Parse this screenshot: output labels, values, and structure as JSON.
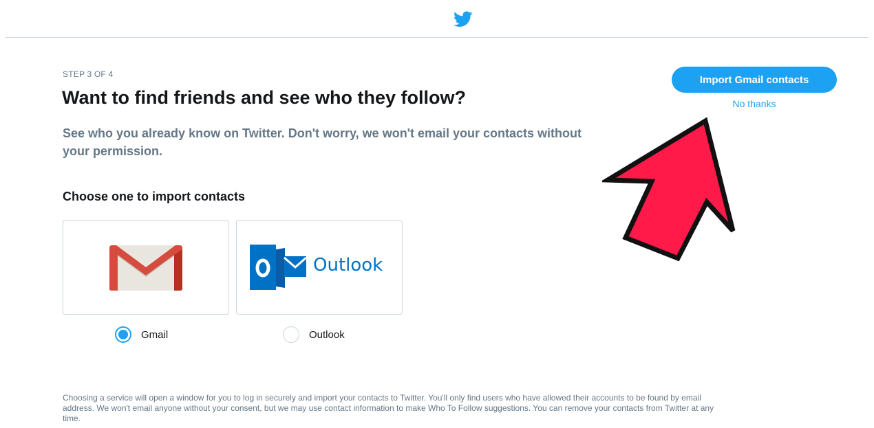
{
  "header": {
    "logo_icon": "twitter-bird-icon",
    "brand_color": "#1da1f2"
  },
  "main": {
    "step": "STEP 3 OF 4",
    "title": "Want to find friends and see who they follow?",
    "subtitle": "See who you already know on Twitter. Don't worry, we won't email your contacts without your permission.",
    "choose_label": "Choose one to import contacts",
    "providers": [
      {
        "icon": "gmail-logo-icon",
        "label": "Gmail",
        "selected": true
      },
      {
        "icon": "outlook-logo-icon",
        "label": "Outlook",
        "logo_text": "Outlook",
        "selected": false
      }
    ],
    "footer": "Choosing a service will open a window for you to log in securely and import your contacts to Twitter. You'll only find users who have allowed their accounts to be found by email address. We won't email anyone without your consent, but we may use contact information to make Who To Follow suggestions. You can remove your contacts from Twitter at any time."
  },
  "actions": {
    "import_label": "Import Gmail contacts",
    "skip_label": "No thanks"
  },
  "annotation": {
    "icon": "red-arrow-icon",
    "color": "#ff1a4a"
  }
}
